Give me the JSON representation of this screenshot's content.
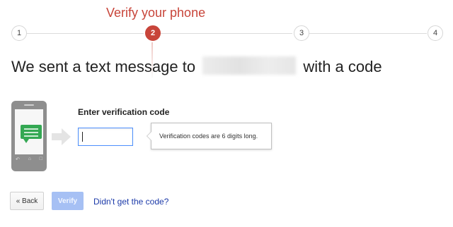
{
  "stepper": {
    "title": "Verify your phone",
    "steps": [
      {
        "label": "1",
        "active": false
      },
      {
        "label": "2",
        "active": true
      },
      {
        "label": "3",
        "active": false
      },
      {
        "label": "4",
        "active": false
      }
    ]
  },
  "headline": {
    "prefix": "We sent a text message to",
    "suffix": "with a code"
  },
  "form": {
    "label": "Enter verification code",
    "input_value": "",
    "hint": "Verification codes are 6 digits long."
  },
  "actions": {
    "back_label": "« Back",
    "verify_label": "Verify",
    "resend_label": "Didn't get the code?"
  },
  "colors": {
    "active_step": "#c8453a",
    "link": "#1c3aa9",
    "verify_disabled": "#a6c0f4",
    "bubble": "#34a853"
  },
  "icons": {
    "phone": "phone-message-icon",
    "arrow": "arrow-right-icon"
  }
}
